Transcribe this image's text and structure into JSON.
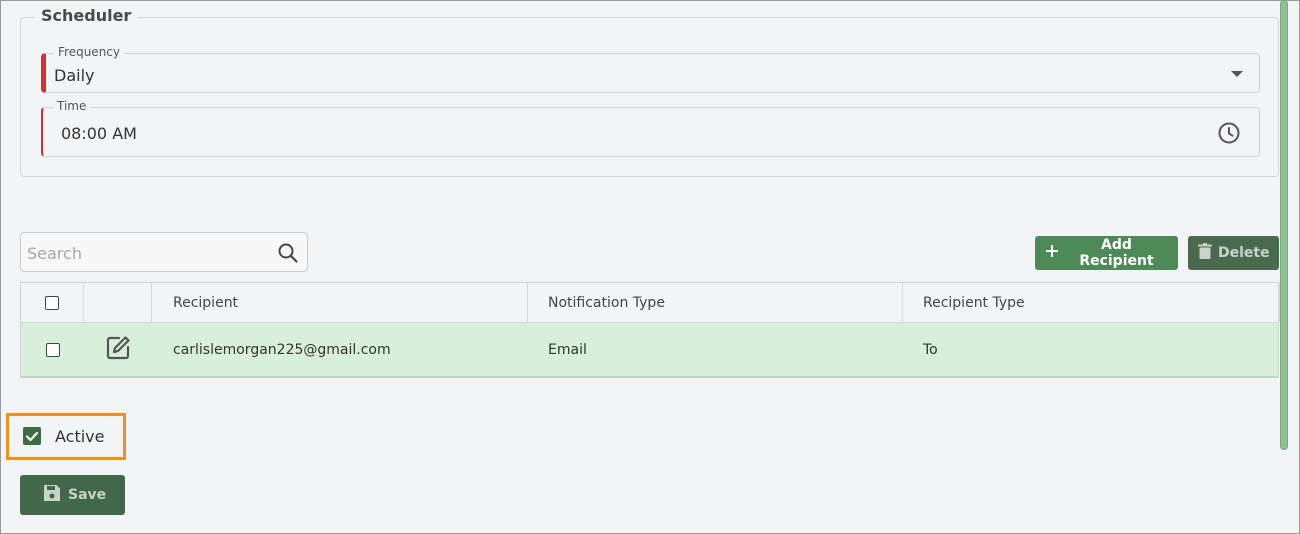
{
  "scheduler": {
    "legend": "Scheduler",
    "frequency": {
      "label": "Frequency",
      "value": "Daily"
    },
    "time": {
      "label": "Time",
      "value": "08:00 AM"
    }
  },
  "search": {
    "placeholder": "Search"
  },
  "toolbar": {
    "add_label": "Add Recipient",
    "delete_label": "Delete"
  },
  "table": {
    "headers": [
      "",
      "",
      "Recipient",
      "Notification Type",
      "Recipient Type"
    ],
    "rows": [
      {
        "recipient": "carlislemorgan225@gmail.com",
        "notification_type": "Email",
        "recipient_type": "To"
      }
    ]
  },
  "active": {
    "label": "Active",
    "checked": true
  },
  "save_label": "Save",
  "colors": {
    "accent": "#4e8a58",
    "row_highlight": "#d8efda",
    "required": "#d32f2f",
    "focus_outline": "#f0921a"
  }
}
